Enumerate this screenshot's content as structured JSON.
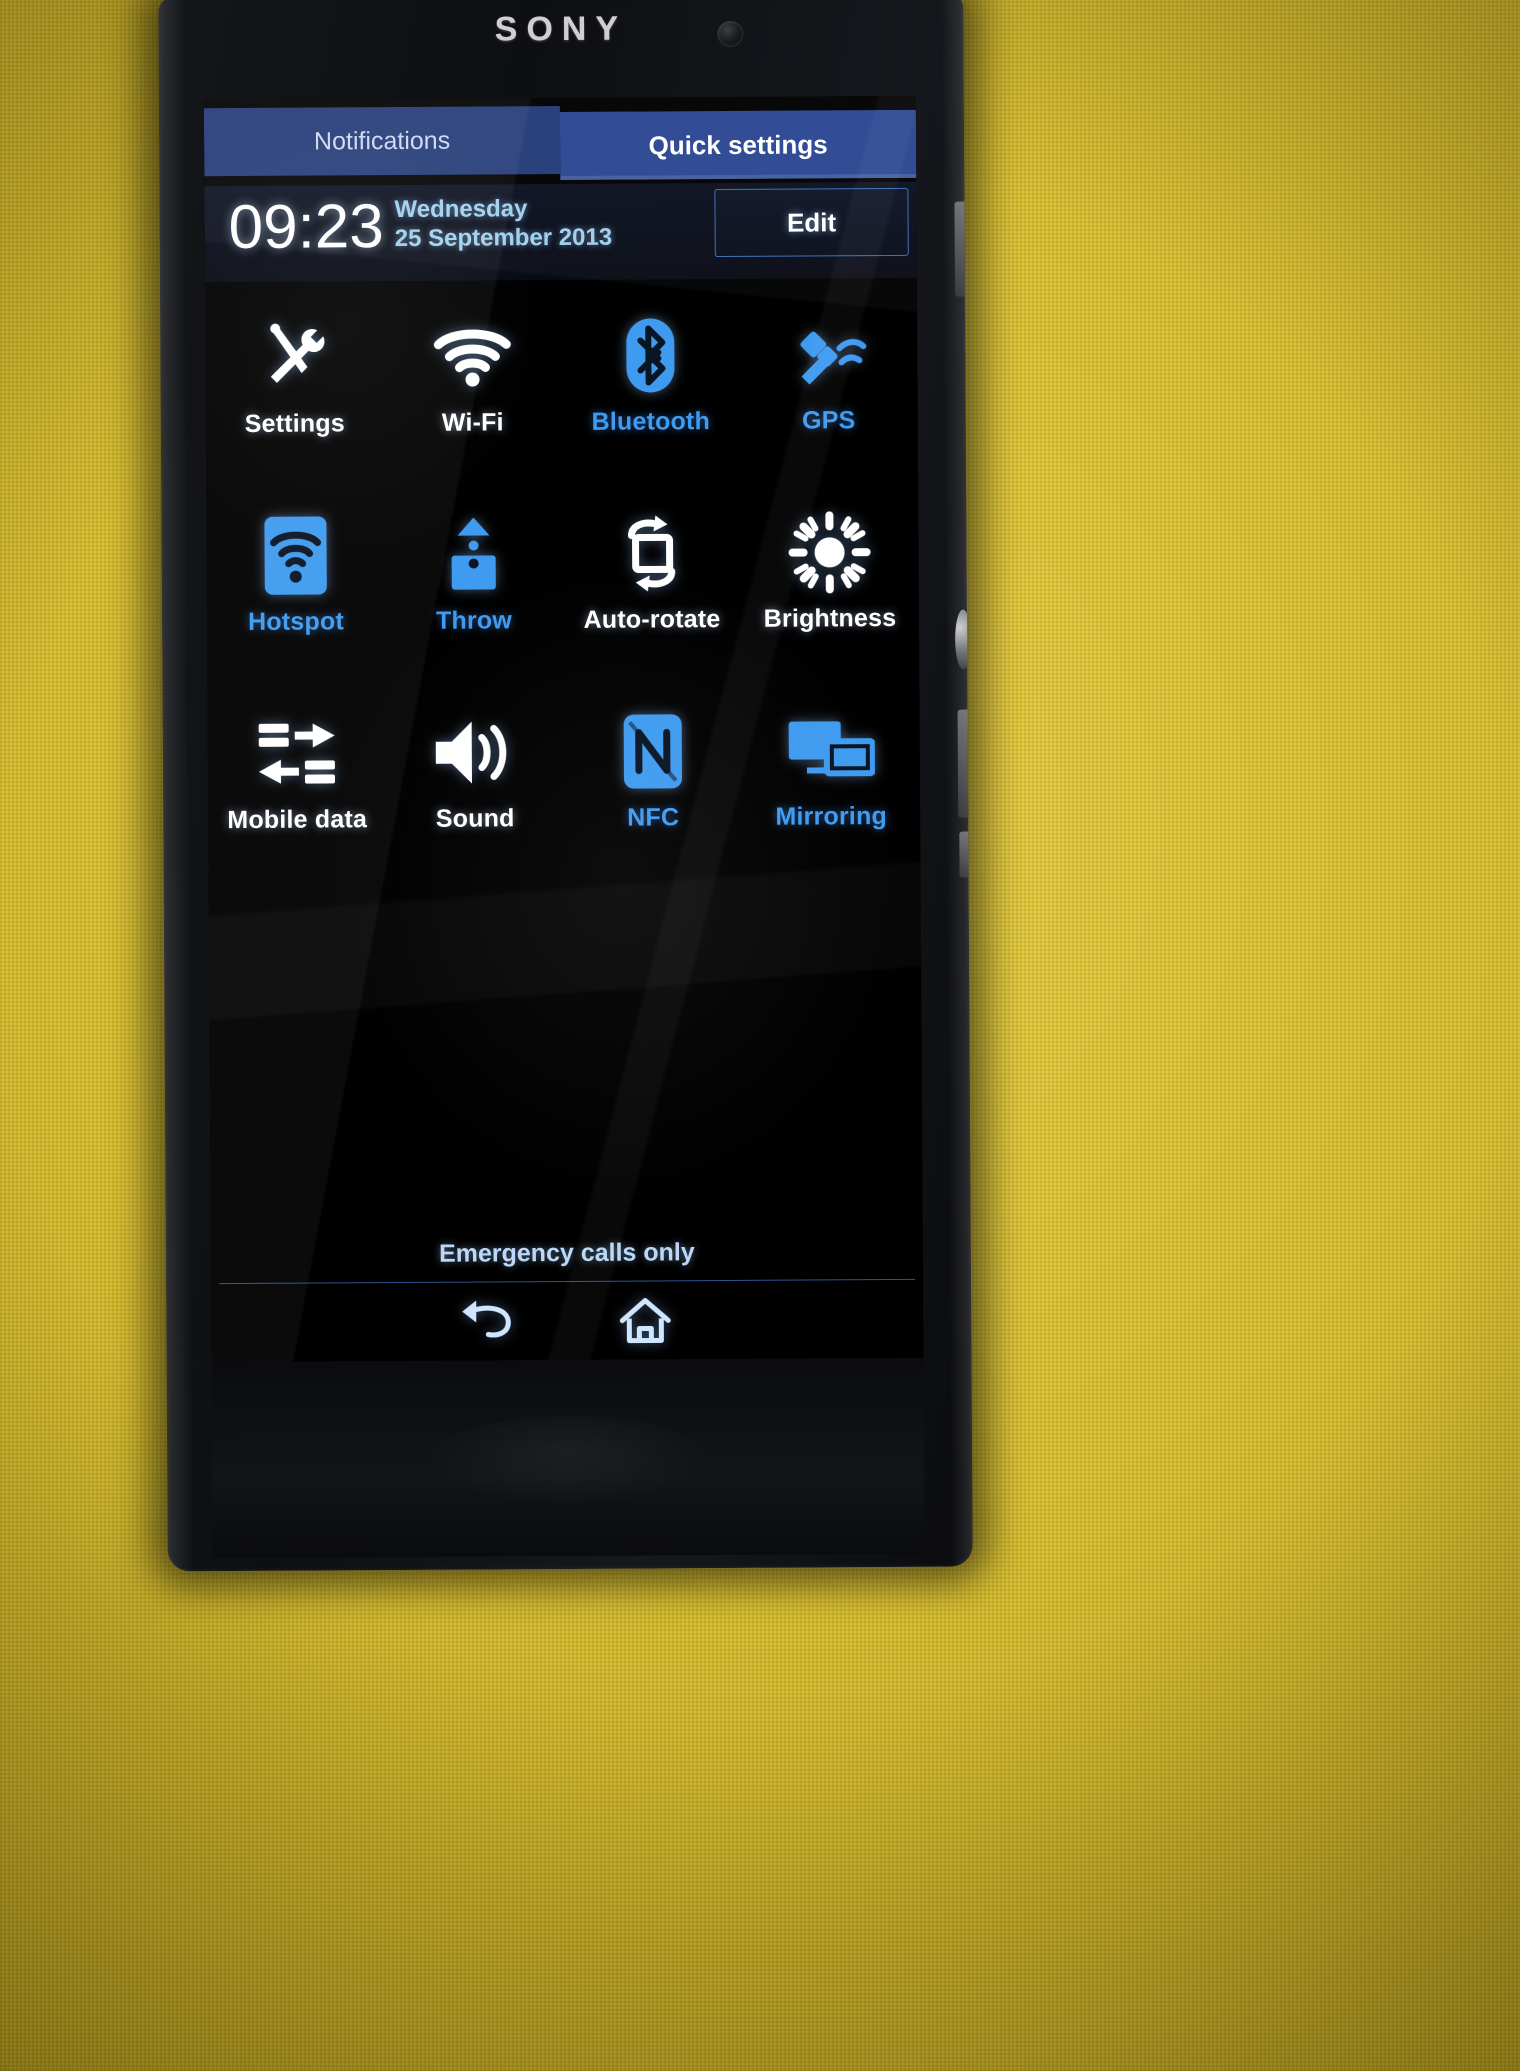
{
  "device": {
    "brand": "SONY",
    "front_camera_icon": "front-camera-icon"
  },
  "tabs": [
    {
      "id": "notifications",
      "label": "Notifications",
      "active": false
    },
    {
      "id": "quick-settings",
      "label": "Quick settings",
      "active": true
    }
  ],
  "status": {
    "time": "09:23",
    "day_name": "Wednesday",
    "date": "25 September 2013",
    "edit_label": "Edit"
  },
  "colors": {
    "accent_blue": "#3f9bf0",
    "tab_active_bg": "#2b4792",
    "tab_inactive_bg": "#243b77",
    "label_on": "#ffffff",
    "label_off": "#3f9bf0",
    "screen_bg": "#000000",
    "edit_border": "#3d6fb8",
    "divider": "#2d5590",
    "body_yellow": "#d9bf2c"
  },
  "quick_settings": {
    "rows": [
      [
        {
          "label": "Settings",
          "icon": "settings-tools-icon",
          "state": "on"
        },
        {
          "label": "Wi-Fi",
          "icon": "wifi-icon",
          "state": "on"
        },
        {
          "label": "Bluetooth",
          "icon": "bluetooth-icon",
          "state": "off"
        },
        {
          "label": "GPS",
          "icon": "gps-satellite-icon",
          "state": "off"
        }
      ],
      [
        {
          "label": "Hotspot",
          "icon": "hotspot-icon",
          "state": "off"
        },
        {
          "label": "Throw",
          "icon": "throw-cast-icon",
          "state": "off"
        },
        {
          "label": "Auto-rotate",
          "icon": "auto-rotate-icon",
          "state": "on"
        },
        {
          "label": "Brightness",
          "icon": "brightness-sun-icon",
          "state": "on"
        }
      ],
      [
        {
          "label": "Mobile data",
          "icon": "mobile-data-icon",
          "state": "on"
        },
        {
          "label": "Sound",
          "icon": "sound-speaker-icon",
          "state": "on"
        },
        {
          "label": "NFC",
          "icon": "nfc-icon",
          "state": "off"
        },
        {
          "label": "Mirroring",
          "icon": "screen-mirroring-icon",
          "state": "off"
        }
      ]
    ]
  },
  "footer": {
    "carrier_status": "Emergency calls only"
  },
  "navbar": [
    {
      "id": "back",
      "icon": "back-arrow-icon"
    },
    {
      "id": "home",
      "icon": "home-icon"
    }
  ]
}
